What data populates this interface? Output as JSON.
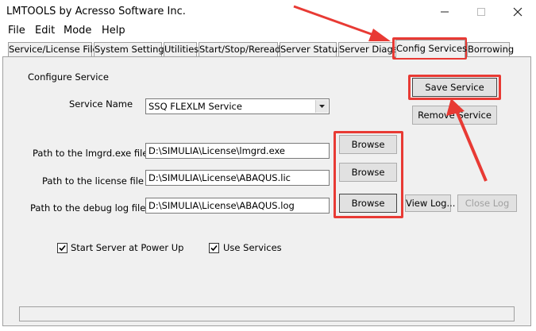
{
  "window": {
    "title": "LMTOOLS by Acresso Software Inc.",
    "minimize_icon": "minimize-icon",
    "maximize_icon": "maximize-icon",
    "close_icon": "close-icon"
  },
  "menu": {
    "items": [
      {
        "label": "File"
      },
      {
        "label": "Edit"
      },
      {
        "label": "Mode"
      },
      {
        "label": "Help"
      }
    ]
  },
  "tabs": [
    {
      "label": "Service/License File"
    },
    {
      "label": "System Settings"
    },
    {
      "label": "Utilities"
    },
    {
      "label": "Start/Stop/Reread"
    },
    {
      "label": "Server Status"
    },
    {
      "label": "Server Diags"
    },
    {
      "label": "Config Services",
      "active": true
    },
    {
      "label": "Borrowing"
    }
  ],
  "config": {
    "section_label": "Configure Service",
    "service_name_label": "Service Name",
    "service_name_value": "SSQ FLEXLM Service",
    "lmgrd_label": "Path to the lmgrd.exe file",
    "lmgrd_value": "D:\\SIMULIA\\License\\lmgrd.exe",
    "license_label": "Path to the license file",
    "license_value": "D:\\SIMULIA\\License\\ABAQUS.lic",
    "debug_label": "Path to the debug log file",
    "debug_value": "D:\\SIMULIA\\License\\ABAQUS.log",
    "browse_label": "Browse",
    "save_label": "Save Service",
    "remove_label": "Remove Service",
    "view_log_label": "View Log...",
    "close_log_label": "Close Log",
    "start_at_powerup_label": "Start Server at Power Up",
    "start_at_powerup_checked": true,
    "use_services_label": "Use Services",
    "use_services_checked": true
  },
  "annotation_color": "#e83a34"
}
